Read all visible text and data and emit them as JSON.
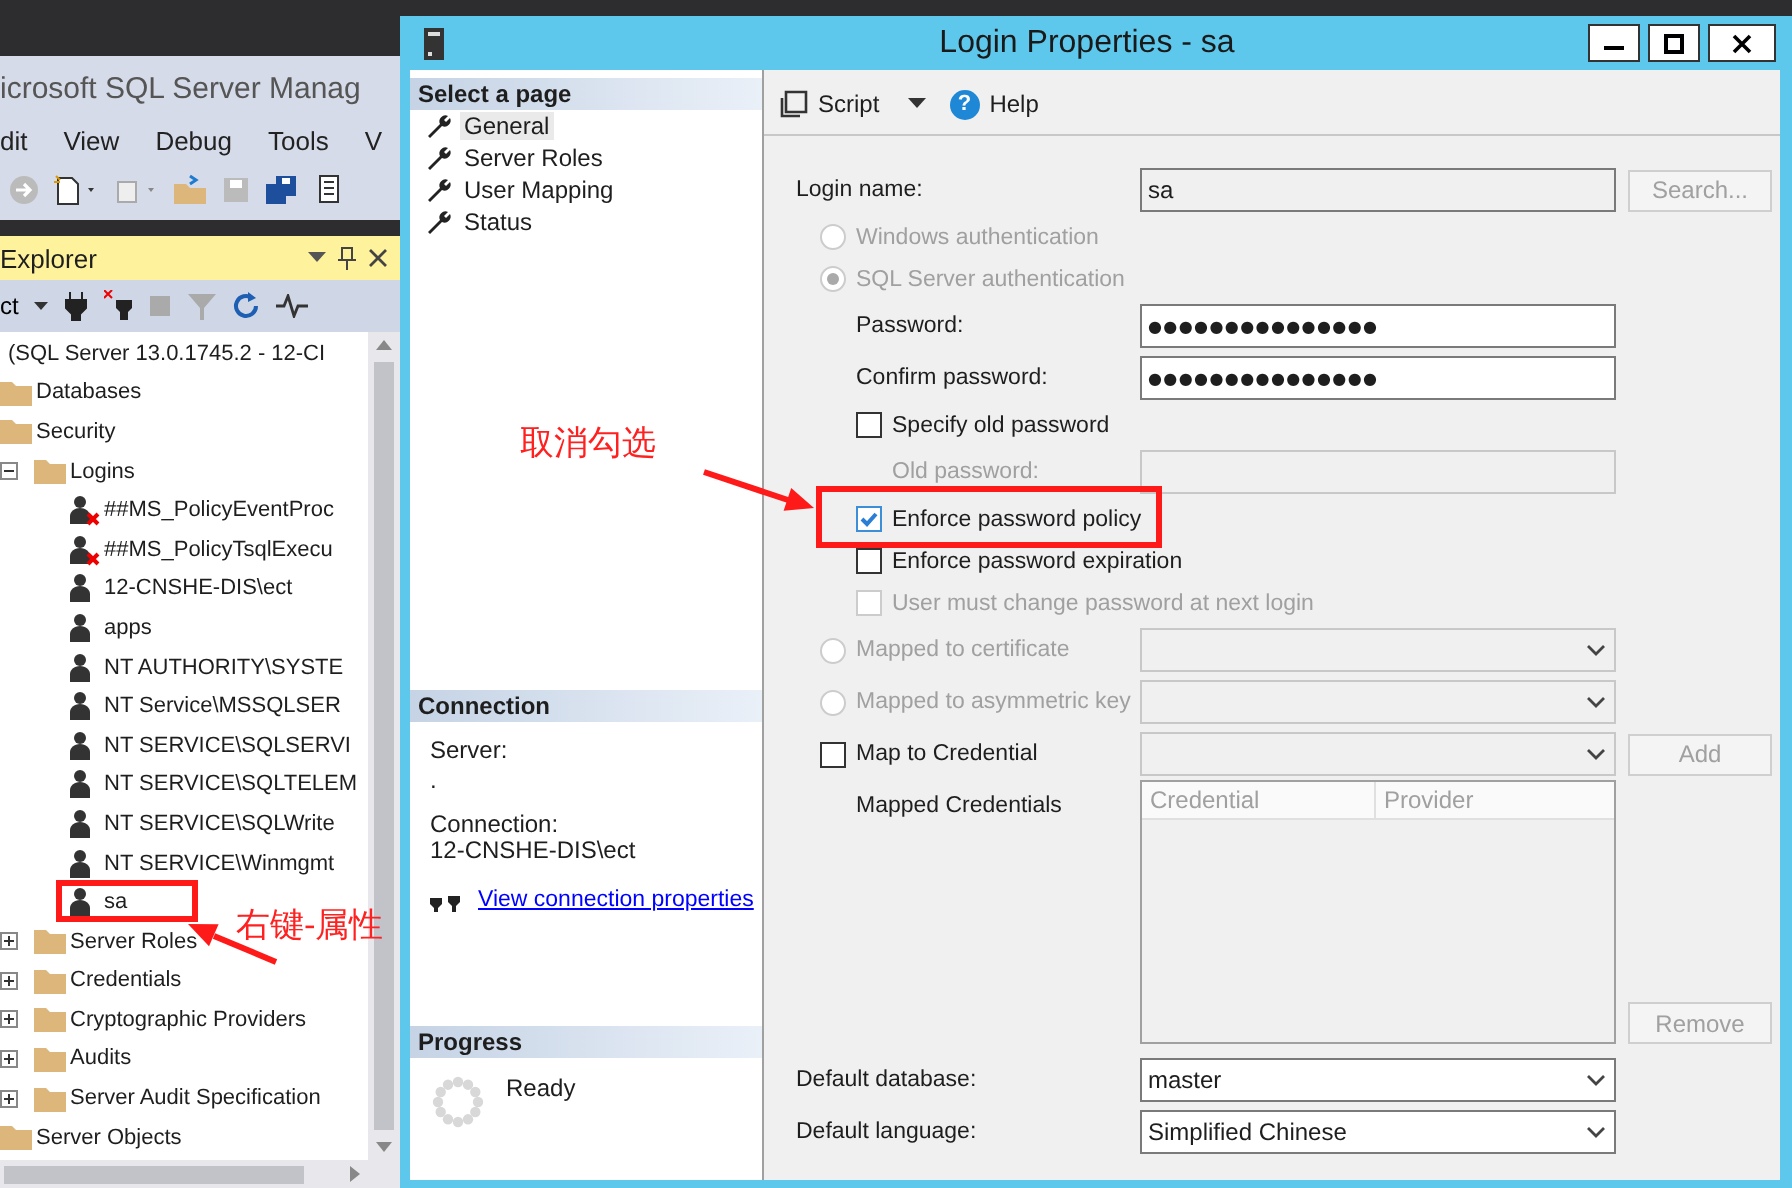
{
  "app": {
    "title": "icrosoft SQL Server Manag",
    "menu": [
      "dit",
      "View",
      "Debug",
      "Tools",
      "V"
    ],
    "explorer": {
      "title": "Explorer",
      "connect_label": "ct",
      "tree": [
        {
          "label": "(SQL Server 13.0.1745.2 - 12-CI",
          "kind": "server",
          "children": [
            {
              "label": "Databases",
              "kind": "folder"
            },
            {
              "label": "Security",
              "kind": "folder",
              "children": [
                {
                  "label": "Logins",
                  "kind": "folder",
                  "expanded": true,
                  "children": [
                    {
                      "label": "##MS_PolicyEventProc",
                      "kind": "login",
                      "disabled": true
                    },
                    {
                      "label": "##MS_PolicyTsqlExecu",
                      "kind": "login",
                      "disabled": true
                    },
                    {
                      "label": "12-CNSHE-DIS\\ect",
                      "kind": "login",
                      "disabled": false
                    },
                    {
                      "label": "apps",
                      "kind": "login",
                      "disabled": false
                    },
                    {
                      "label": "NT AUTHORITY\\SYSTE",
                      "kind": "login",
                      "disabled": false
                    },
                    {
                      "label": "NT Service\\MSSQLSER",
                      "kind": "login",
                      "disabled": false
                    },
                    {
                      "label": "NT SERVICE\\SQLSERVI",
                      "kind": "login",
                      "disabled": false
                    },
                    {
                      "label": "NT SERVICE\\SQLTELEM",
                      "kind": "login",
                      "disabled": false
                    },
                    {
                      "label": "NT SERVICE\\SQLWrite",
                      "kind": "login",
                      "disabled": false
                    },
                    {
                      "label": "NT SERVICE\\Winmgmt",
                      "kind": "login",
                      "disabled": false
                    },
                    {
                      "label": "sa",
                      "kind": "login",
                      "disabled": false
                    }
                  ]
                },
                {
                  "label": "Server Roles",
                  "kind": "folder",
                  "expanded": false
                },
                {
                  "label": "Credentials",
                  "kind": "folder",
                  "expanded": false
                },
                {
                  "label": "Cryptographic Providers",
                  "kind": "folder",
                  "expanded": false
                },
                {
                  "label": "Audits",
                  "kind": "folder",
                  "expanded": false
                },
                {
                  "label": "Server Audit Specification",
                  "kind": "folder",
                  "expanded": false
                }
              ]
            },
            {
              "label": "Server Objects",
              "kind": "folder"
            }
          ]
        }
      ]
    }
  },
  "dialog": {
    "title": "Login Properties - sa",
    "select_page": {
      "heading": "Select a page",
      "items": [
        {
          "label": "General",
          "selected": true
        },
        {
          "label": "Server Roles",
          "selected": false
        },
        {
          "label": "User Mapping",
          "selected": false
        },
        {
          "label": "Status",
          "selected": false
        }
      ]
    },
    "connection": {
      "heading": "Connection",
      "server_label": "Server:",
      "server": ".",
      "connection_label": "Connection:",
      "connection": "12-CNSHE-DIS\\ect",
      "link": "View connection properties"
    },
    "progress": {
      "heading": "Progress",
      "status": "Ready"
    },
    "toolbar": {
      "script": "Script",
      "help_icon": "?",
      "help": "Help"
    },
    "form": [
      {
        "kind": "text_field",
        "label": "Login name:",
        "value": "sa",
        "readonly": true,
        "button": {
          "label": "Search...",
          "disabled": true
        }
      },
      {
        "kind": "radio",
        "label": "Windows authentication",
        "selected": false,
        "disabled": true
      },
      {
        "kind": "radio",
        "label": "SQL Server authentication",
        "selected": true,
        "disabled": true,
        "children": [
          {
            "kind": "password_field",
            "label": "Password:",
            "value": "●●●●●●●●●●●●●●●",
            "disabled": false
          },
          {
            "kind": "password_field",
            "label": "Confirm password:",
            "value": "●●●●●●●●●●●●●●●",
            "disabled": false
          },
          {
            "kind": "checkbox",
            "label": "Specify old password",
            "checked": false,
            "disabled": false,
            "children": [
              {
                "kind": "password_field",
                "label": "Old password:",
                "disabled": true
              }
            ]
          },
          {
            "kind": "checkbox",
            "label": "Enforce password policy",
            "checked": true,
            "disabled": false
          },
          {
            "kind": "checkbox",
            "label": "Enforce password expiration",
            "checked": false,
            "disabled": false
          },
          {
            "kind": "checkbox",
            "label": "User must change password at next login",
            "checked": false,
            "disabled": true
          }
        ]
      },
      {
        "kind": "radio",
        "label": "Mapped to certificate",
        "selected": false,
        "disabled": true,
        "dropdown": {
          "disabled": true
        }
      },
      {
        "kind": "radio",
        "label": "Mapped to asymmetric key",
        "selected": false,
        "disabled": true,
        "dropdown": {
          "disabled": true
        }
      },
      {
        "kind": "checkbox",
        "label": "Map to Credential",
        "checked": false,
        "disabled": false,
        "dropdown": {
          "disabled": true
        },
        "button": {
          "label": "Add",
          "disabled": true
        },
        "children": [
          {
            "kind": "list",
            "label": "Mapped Credentials",
            "columns": [
              "Credential",
              "Provider"
            ],
            "disabled": true,
            "button": {
              "label": "Remove",
              "disabled": true
            }
          }
        ]
      },
      {
        "kind": "dropdown",
        "label": "Default database:",
        "value": "master",
        "disabled": false
      },
      {
        "kind": "dropdown",
        "label": "Default language:",
        "value": "Simplified Chinese",
        "disabled": false
      }
    ]
  },
  "annotations": [
    {
      "text": "取消勾选"
    },
    {
      "text": "右键-属性"
    }
  ]
}
